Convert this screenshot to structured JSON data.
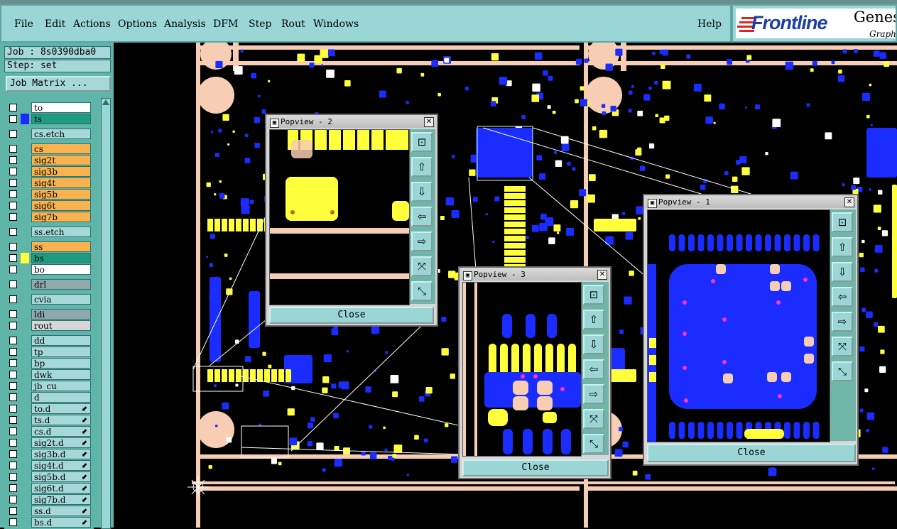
{
  "menubar": {
    "items": [
      {
        "label": "File"
      },
      {
        "label": "Edit"
      },
      {
        "label": "Actions"
      },
      {
        "label": "Options"
      },
      {
        "label": "Analysis"
      },
      {
        "label": "DFM"
      },
      {
        "label": "Step"
      },
      {
        "label": "Rout"
      },
      {
        "label": "Windows"
      }
    ],
    "help": "Help"
  },
  "logo": {
    "brand": "Frontline",
    "product": "Genes",
    "tagline": "Graph"
  },
  "panel": {
    "job": "Job : 8s0390dba0",
    "step": "Step: set",
    "job_matrix": "Job Matrix ..."
  },
  "layers": [
    {
      "name": "to",
      "color": "#ffffff",
      "marker": ""
    },
    {
      "name": "ts",
      "color": "#1f9b7f",
      "marker": "#1a2cff"
    },
    {
      "name": "cs.etch",
      "color": "#a7d8d8",
      "marker": ""
    },
    {
      "name": "cs",
      "color": "#f9b24e",
      "marker": ""
    },
    {
      "name": "sig2t",
      "color": "#f9b24e",
      "marker": ""
    },
    {
      "name": "sig3b",
      "color": "#f9b24e",
      "marker": ""
    },
    {
      "name": "sig4t",
      "color": "#f9b24e",
      "marker": ""
    },
    {
      "name": "sig5b",
      "color": "#f9b24e",
      "marker": ""
    },
    {
      "name": "sig6t",
      "color": "#f9b24e",
      "marker": ""
    },
    {
      "name": "sig7b",
      "color": "#f9b24e",
      "marker": ""
    },
    {
      "name": "ss.etch",
      "color": "#a7d8d8",
      "marker": ""
    },
    {
      "name": "ss",
      "color": "#f9b24e",
      "marker": ""
    },
    {
      "name": "bs",
      "color": "#1f9b7f",
      "marker": "#ffff3c"
    },
    {
      "name": "bo",
      "color": "#ffffff",
      "marker": ""
    },
    {
      "name": "drl",
      "color": "#8fa9ad",
      "marker": ""
    },
    {
      "name": "cvia",
      "color": "#a7d8d8",
      "marker": ""
    },
    {
      "name": "ldi",
      "color": "#8fa9ad",
      "marker": ""
    },
    {
      "name": "rout",
      "color": "#d6d6d6",
      "marker": ""
    },
    {
      "name": "dd",
      "color": "#a7d8d8",
      "marker": ""
    },
    {
      "name": "tp",
      "color": "#a7d8d8",
      "marker": ""
    },
    {
      "name": "bp",
      "color": "#a7d8d8",
      "marker": ""
    },
    {
      "name": "dwk",
      "color": "#a7d8d8",
      "marker": ""
    },
    {
      "name": "jb_cu",
      "color": "#a7d8d8",
      "marker": ""
    },
    {
      "name": "d",
      "color": "#a7d8d8",
      "marker": ""
    },
    {
      "name": "to.d",
      "color": "#a7d8d8",
      "marker": "",
      "arrow": true
    },
    {
      "name": "ts.d",
      "color": "#a7d8d8",
      "marker": "",
      "arrow": true
    },
    {
      "name": "cs.d",
      "color": "#a7d8d8",
      "marker": "",
      "arrow": true
    },
    {
      "name": "sig2t.d",
      "color": "#a7d8d8",
      "marker": "",
      "arrow": true
    },
    {
      "name": "sig3b.d",
      "color": "#a7d8d8",
      "marker": "",
      "arrow": true
    },
    {
      "name": "sig4t.d",
      "color": "#a7d8d8",
      "marker": "",
      "arrow": true
    },
    {
      "name": "sig5b.d",
      "color": "#a7d8d8",
      "marker": "",
      "arrow": true
    },
    {
      "name": "sig6t.d",
      "color": "#a7d8d8",
      "marker": "",
      "arrow": true
    },
    {
      "name": "sig7b.d",
      "color": "#a7d8d8",
      "marker": "",
      "arrow": true
    },
    {
      "name": "ss.d",
      "color": "#a7d8d8",
      "marker": "",
      "arrow": true
    },
    {
      "name": "bs.d",
      "color": "#a7d8d8",
      "marker": "",
      "arrow": true
    }
  ],
  "popups": [
    {
      "title": "Popview - 2",
      "close": "Close"
    },
    {
      "title": "Popview - 3",
      "close": "Close"
    },
    {
      "title": "Popview - 1",
      "close": "Close"
    }
  ],
  "colors": {
    "pad": "#1a2cff",
    "signal": "#ffff3c",
    "board": "#f7cdb3",
    "accent": "#9bd6d6"
  }
}
